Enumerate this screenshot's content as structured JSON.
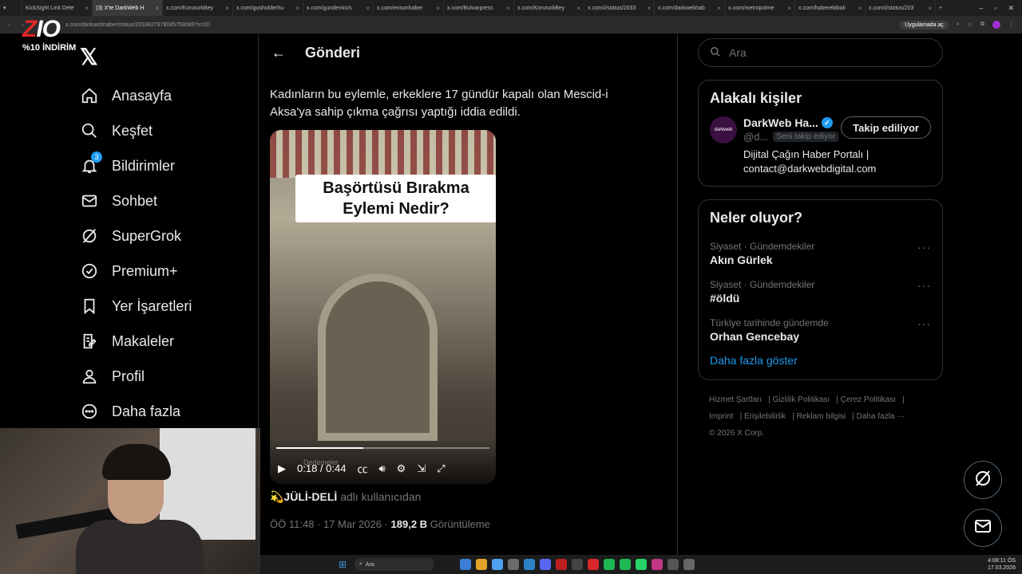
{
  "browser": {
    "tabs": [
      {
        "label": "KickSight Link Dete"
      },
      {
        "label": "(3) X'te DarkWeb H",
        "active": true
      },
      {
        "label": "x.com/KoruturkBey"
      },
      {
        "label": "x.com/gusholderhu"
      },
      {
        "label": "x.com/gundemio/s"
      },
      {
        "label": "x.com/ensonhaber"
      },
      {
        "label": "x.com/Bulvarpress"
      },
      {
        "label": "x.com/KoruturkBey"
      },
      {
        "label": "x.com/i/status/2033"
      },
      {
        "label": "x.com/darkwebhab"
      },
      {
        "label": "x.com/metropolme"
      },
      {
        "label": "x.com/haberebibali"
      },
      {
        "label": "x.com/i/status/203"
      }
    ],
    "url": "x.com/darkwebhaber/status/2033827878085759089?s=20",
    "app_pill": "Uygulamada aç"
  },
  "overlay": {
    "brand_z": "Z",
    "brand_io": "IO",
    "discount": "%10 İNDİRİM"
  },
  "nav": {
    "items": [
      {
        "label": "Anasayfa",
        "icon": "home-icon"
      },
      {
        "label": "Keşfet",
        "icon": "search-icon"
      },
      {
        "label": "Bildirimler",
        "icon": "bell-icon",
        "badge": "3"
      },
      {
        "label": "Sohbet",
        "icon": "mail-icon"
      },
      {
        "label": "SuperGrok",
        "icon": "grok-icon"
      },
      {
        "label": "Premium+",
        "icon": "premium-icon"
      },
      {
        "label": "Yer İşaretleri",
        "icon": "bookmark-icon"
      },
      {
        "label": "Makaleler",
        "icon": "articles-icon"
      },
      {
        "label": "Profil",
        "icon": "profile-icon"
      },
      {
        "label": "Daha fazla",
        "icon": "more-icon"
      }
    ]
  },
  "post": {
    "header_title": "Gönderi",
    "text": "Kadınların bu eylemle, erkeklere 17 gündür kapalı olan Mescid-i Aksa'ya sahip çıkma çağrısı yaptığı iddia edildi.",
    "video": {
      "caption_line1": "Başörtüsü Bırakma",
      "caption_line2": "Eylemi Nedir?",
      "time": "0:18 / 0:44",
      "watermark": "Derlemeler",
      "progress": 0.41
    },
    "credit_user": "💫JÜLİ-DELİ",
    "credit_suffix": "adlı kullanıcıdan",
    "timestamp": "ÖÖ 11:48 · 17 Mar 2026 ·",
    "views_count": "189,2 B",
    "views_label": "Görüntüleme"
  },
  "sidebar": {
    "search_placeholder": "Ara",
    "related": {
      "title": "Alakalı kişiler",
      "name": "DarkWeb Ha...",
      "handle": "@d...",
      "follows_you": "Seni takip ediyor",
      "follow_button": "Takip ediliyor",
      "bio": "Dijital Çağın Haber Portalı | contact@darkwebdigital.com",
      "avatar_text": "darkweb"
    },
    "trends": {
      "title": "Neler oluyor?",
      "items": [
        {
          "category": "Siyaset · Gündemdekiler",
          "name": "Akın Gürlek"
        },
        {
          "category": "Siyaset · Gündemdekiler",
          "name": "#öldü"
        },
        {
          "category": "Türkiye tarihinde gündemde",
          "name": "Orhan Gencebay"
        }
      ],
      "show_more": "Daha fazla göster"
    },
    "footer": {
      "links": [
        "Hizmet Şartları",
        "Gizlilik Politikası",
        "Çerez Politikası",
        "Imprint",
        "Erişilebilirlik",
        "Reklam bilgisi",
        "Daha fazla ···"
      ],
      "copyright": "© 2026 X Corp."
    }
  },
  "taskbar": {
    "search": "Ara",
    "time": "4:08:11 ÖS",
    "date": "17.03.2026"
  }
}
